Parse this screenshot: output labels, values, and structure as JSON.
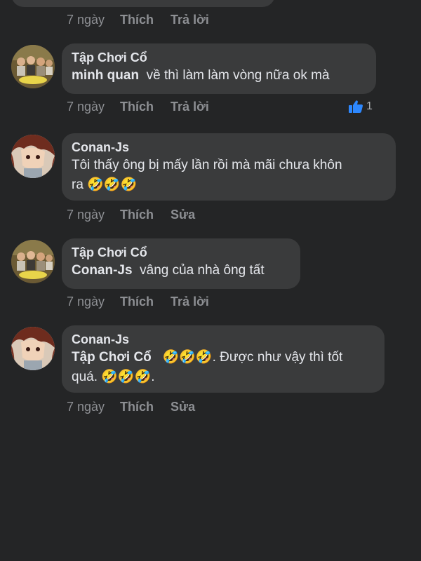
{
  "top_partial": {
    "time": "7 ngày",
    "like": "Thích",
    "reply": "Trả lời"
  },
  "comments": [
    {
      "author": "Tập Chơi Cổ",
      "mention": "minh quan",
      "text": "  về thì làm làm vòng nữa ok mà",
      "time": "7 ngày",
      "like": "Thích",
      "action2": "Trả lời",
      "reaction_count": "1",
      "avatar": "group-photo"
    },
    {
      "author": "Conan-Js",
      "text_line1": "Tôi thấy ông bị mấy lần rồi mà mãi chưa khôn",
      "text_line2": "ra 🤣🤣🤣",
      "time": "7 ngày",
      "like": "Thích",
      "action2": "Sửa",
      "avatar": "anime-character"
    },
    {
      "author": "Tập Chơi Cổ",
      "mention": "Conan-Js",
      "text": "  vâng của nhà ông tất",
      "time": "7 ngày",
      "like": "Thích",
      "action2": "Trả lời",
      "avatar": "group-photo"
    },
    {
      "author": "Conan-Js",
      "mention": "Tập Chơi Cổ",
      "text_line1": "   🤣🤣🤣. Được như vậy thì tốt",
      "text_line2": "quá. 🤣🤣🤣.",
      "time": "7 ngày",
      "like": "Thích",
      "action2": "Sửa",
      "avatar": "anime-character"
    }
  ],
  "colors": {
    "background": "#242526",
    "bubble": "#3a3b3c",
    "text": "#e4e6eb",
    "meta": "#8d8f93",
    "like_blue": "#2d88ff"
  }
}
